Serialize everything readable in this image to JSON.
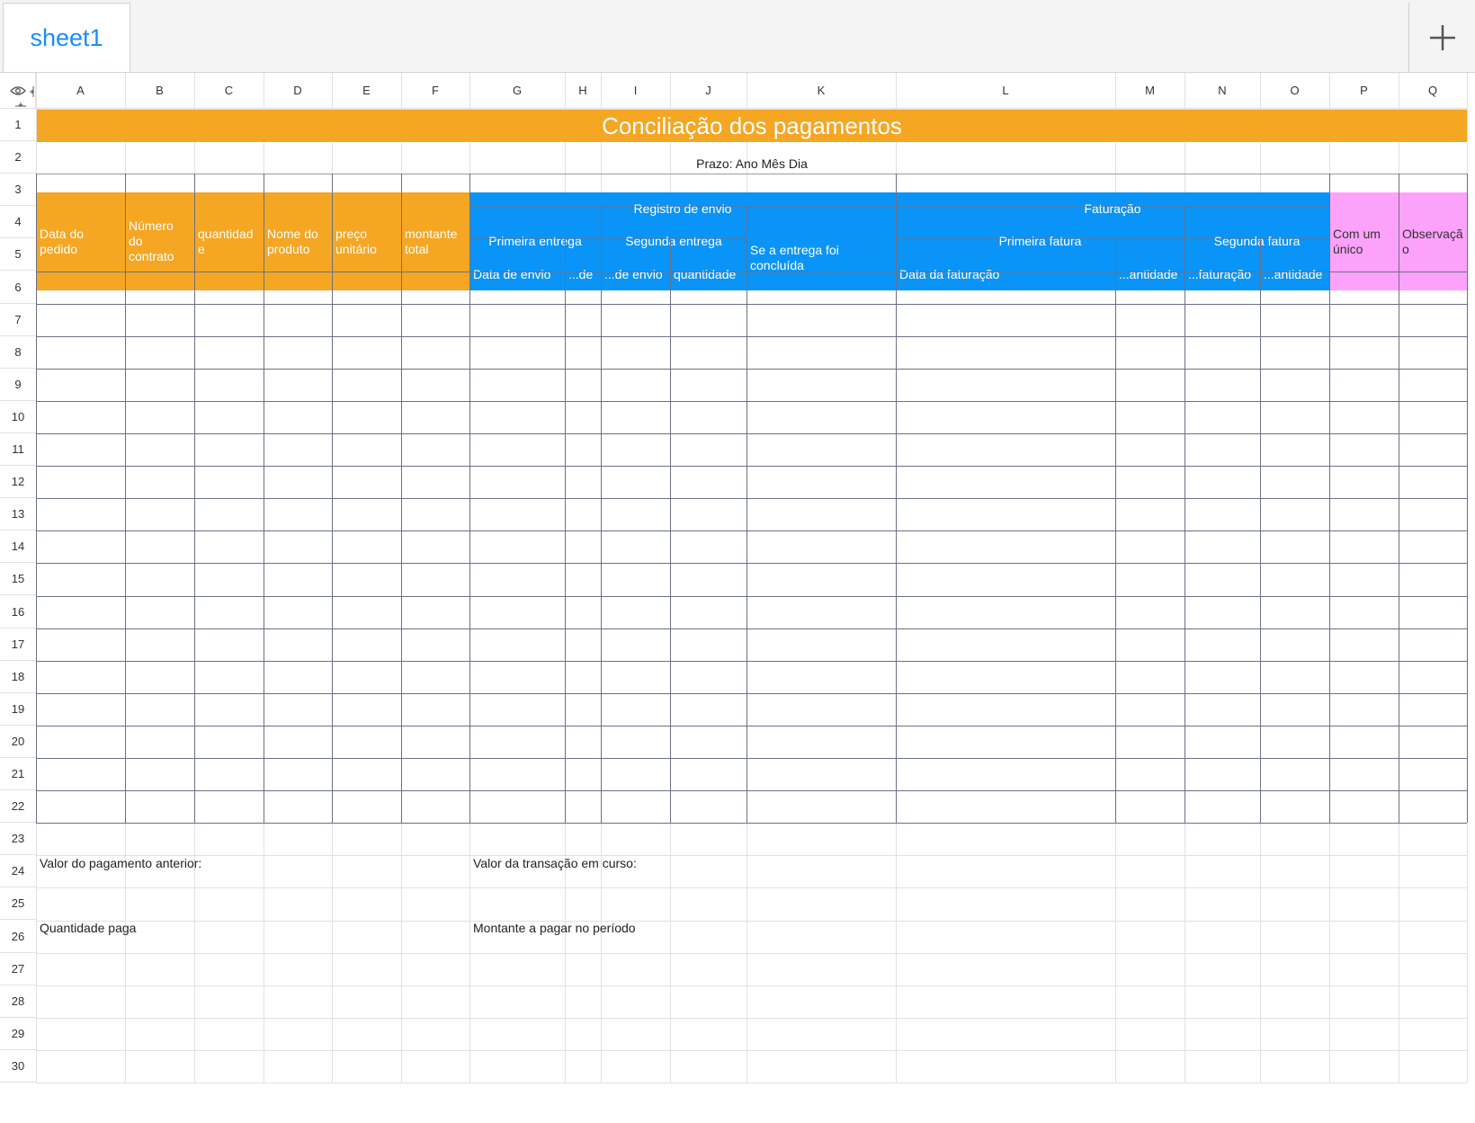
{
  "tabs": {
    "active": "sheet1",
    "add_label": "+"
  },
  "columns": [
    "A",
    "B",
    "C",
    "D",
    "E",
    "F",
    "G",
    "H",
    "I",
    "J",
    "K",
    "L",
    "M",
    "N",
    "O",
    "P",
    "Q"
  ],
  "rows": [
    "1",
    "2",
    "3",
    "4",
    "5",
    "6",
    "7",
    "8",
    "9",
    "10",
    "11",
    "12",
    "13",
    "14",
    "15",
    "16",
    "17",
    "18",
    "19",
    "20",
    "21",
    "22",
    "23",
    "24",
    "25",
    "26",
    "27",
    "28",
    "29",
    "30"
  ],
  "sheet": {
    "title": "Conciliação dos pagamentos",
    "deadline": "Prazo: Ano Mês Dia",
    "headers": {
      "order_date": "Data do pedido",
      "contract_number": "Número do contrato",
      "quantity": "quantidade",
      "product_name": "Nome do produto",
      "unit_price": "preço unitário",
      "total_amount": "montante total",
      "shipping_record": "Registro de envio",
      "first_delivery": "Primeira entrega",
      "second_delivery": "Segunda entrega",
      "delivery_completed": "Se a entrega foi concluída",
      "ship_date_1": "Data de envio",
      "ship_qty_1": "...de",
      "ship_date_2": "...de envio",
      "ship_qty_2": "quantidade",
      "billing": "Faturação",
      "first_invoice": "Primeira fatura",
      "second_invoice": "Segunda fatura",
      "invoice_date_1": "Data da faturação",
      "invoice_qty_1": "...antidade",
      "invoice_date_2": "...faturação",
      "invoice_qty_2": "...antidade",
      "single": "Com um único",
      "notes": "Observação"
    },
    "footer": {
      "previous_payment": "Valor do pagamento anterior:",
      "current_transaction": "Valor da transação em curso:",
      "quantity_paid": "Quantidade paga",
      "amount_due_period": "Montante a pagar no período"
    }
  }
}
